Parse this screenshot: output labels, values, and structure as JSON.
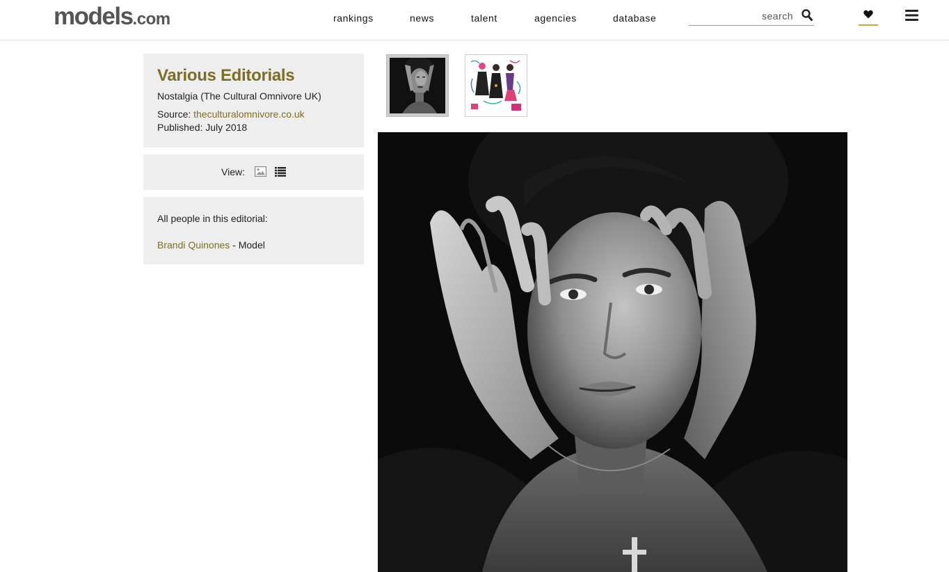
{
  "header": {
    "logo_main": "models",
    "logo_suffix": ".com",
    "nav": [
      {
        "label": "rankings"
      },
      {
        "label": "news"
      },
      {
        "label": "talent"
      },
      {
        "label": "agencies"
      },
      {
        "label": "database"
      }
    ],
    "search": {
      "placeholder": "search",
      "value": ""
    },
    "icons": {
      "search": "search-icon",
      "favorites": "heart-icon",
      "menu": "hamburger-menu-icon"
    },
    "accent_color": "#d4a33c"
  },
  "editorial": {
    "title": "Various Editorials",
    "subtitle": "Nostalgia (The Cultural Omnivore UK)",
    "source_label": "Source:",
    "source_link": "theculturalomnivore.co.uk",
    "published": "Published: July 2018",
    "title_color": "#7d6d22"
  },
  "view": {
    "label": "View:",
    "options": [
      {
        "icon": "image-view-icon"
      },
      {
        "icon": "list-view-icon"
      }
    ]
  },
  "people": {
    "heading": "All people in this editorial:",
    "list": [
      {
        "name": "Brandi Quinones",
        "role": " - Model"
      }
    ]
  },
  "gallery": {
    "thumbnails": [
      {
        "kind": "black-and-white portrait",
        "selected": true
      },
      {
        "kind": "colour illustration",
        "selected": false
      }
    ],
    "main_image": "black-and-white portrait"
  }
}
